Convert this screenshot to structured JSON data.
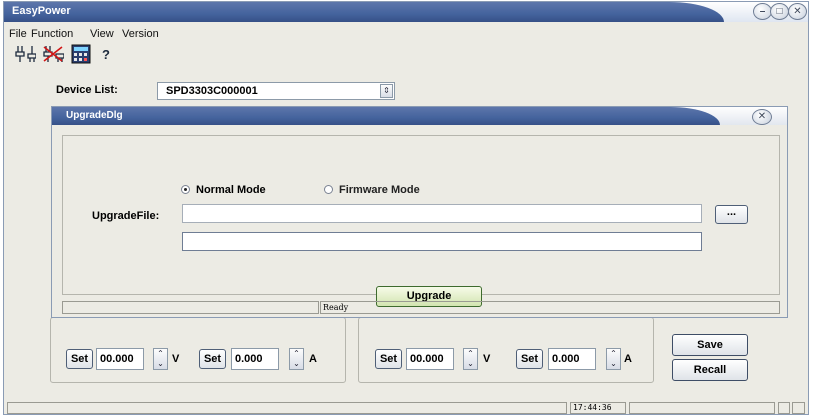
{
  "window": {
    "title": "EasyPower"
  },
  "menu": {
    "items": [
      "File",
      "Function",
      "View",
      "Version"
    ]
  },
  "toolbar": {
    "icons": [
      "connect-icon",
      "disconnect-icon",
      "calculator-icon",
      "help-icon"
    ]
  },
  "device": {
    "label": "Device List:",
    "selected": "SPD3303C000001"
  },
  "upgrade_dialog": {
    "title": "UpgradeDlg",
    "mode_normal": "Normal Mode",
    "mode_firmware": "Firmware Mode",
    "selected_mode": "Normal Mode",
    "file_label": "UpgradeFile:",
    "file_value": "",
    "browse_label": "...",
    "upgrade_label": "Upgrade",
    "status": "Ready"
  },
  "channel1": {
    "set_v_label": "Set",
    "voltage": "00.000",
    "v_unit": "V",
    "set_a_label": "Set",
    "current": "0.000",
    "a_unit": "A"
  },
  "channel2": {
    "set_v_label": "Set",
    "voltage": "00.000",
    "v_unit": "V",
    "set_a_label": "Set",
    "current": "0.000",
    "a_unit": "A"
  },
  "actions": {
    "save": "Save",
    "recall": "Recall"
  },
  "status_bar": {
    "time": "17:44:36"
  }
}
